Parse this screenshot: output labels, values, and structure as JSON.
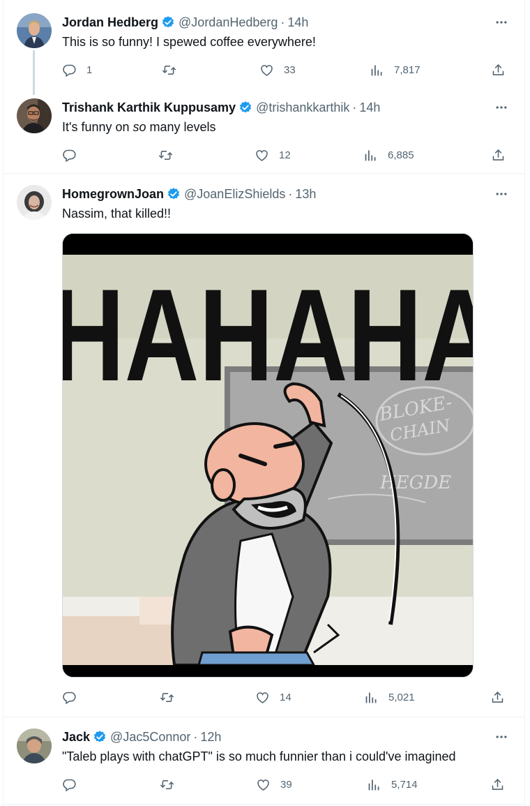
{
  "tweets": [
    {
      "name": "Jordan Hedberg",
      "handle": "@JordanHedberg",
      "dot": "·",
      "time": "14h",
      "text": "This is so funny! I spewed coffee everywhere!",
      "replies": "1",
      "retweets": "",
      "likes": "33",
      "views": "7,817"
    },
    {
      "name": "Trishank Karthik Kuppusamy",
      "handle": "@trishankkarthik",
      "dot": "·",
      "time": "14h",
      "text_before": "It's funny on ",
      "text_em": "so",
      "text_after": " many levels",
      "replies": "",
      "retweets": "",
      "likes": "12",
      "views": "6,885"
    },
    {
      "name": "HomegrownJoan",
      "handle": "@JoanElizShields",
      "dot": "·",
      "time": "13h",
      "text": "Nassim, that killed!!",
      "media_text": "HAHAHA",
      "board_text_1": "BLOKE-",
      "board_text_2": "CHAIN",
      "board_text_3": "HEGDE",
      "replies": "",
      "retweets": "",
      "likes": "14",
      "views": "5,021"
    },
    {
      "name": "Jack",
      "handle": "@Jac5Connor",
      "dot": "·",
      "time": "12h",
      "text": "\"Taleb plays with chatGPT\" is so much funnier than i could've imagined",
      "replies": "",
      "retweets": "",
      "likes": "39",
      "views": "5,714"
    }
  ],
  "colors": {
    "verified": "#1d9bf0",
    "secondary_text": "#536471",
    "primary_text": "#0f1419",
    "divider": "#eff3f4"
  },
  "icons": [
    "reply-icon",
    "retweet-icon",
    "like-icon",
    "views-icon",
    "share-icon",
    "more-icon",
    "verified-badge-icon"
  ]
}
